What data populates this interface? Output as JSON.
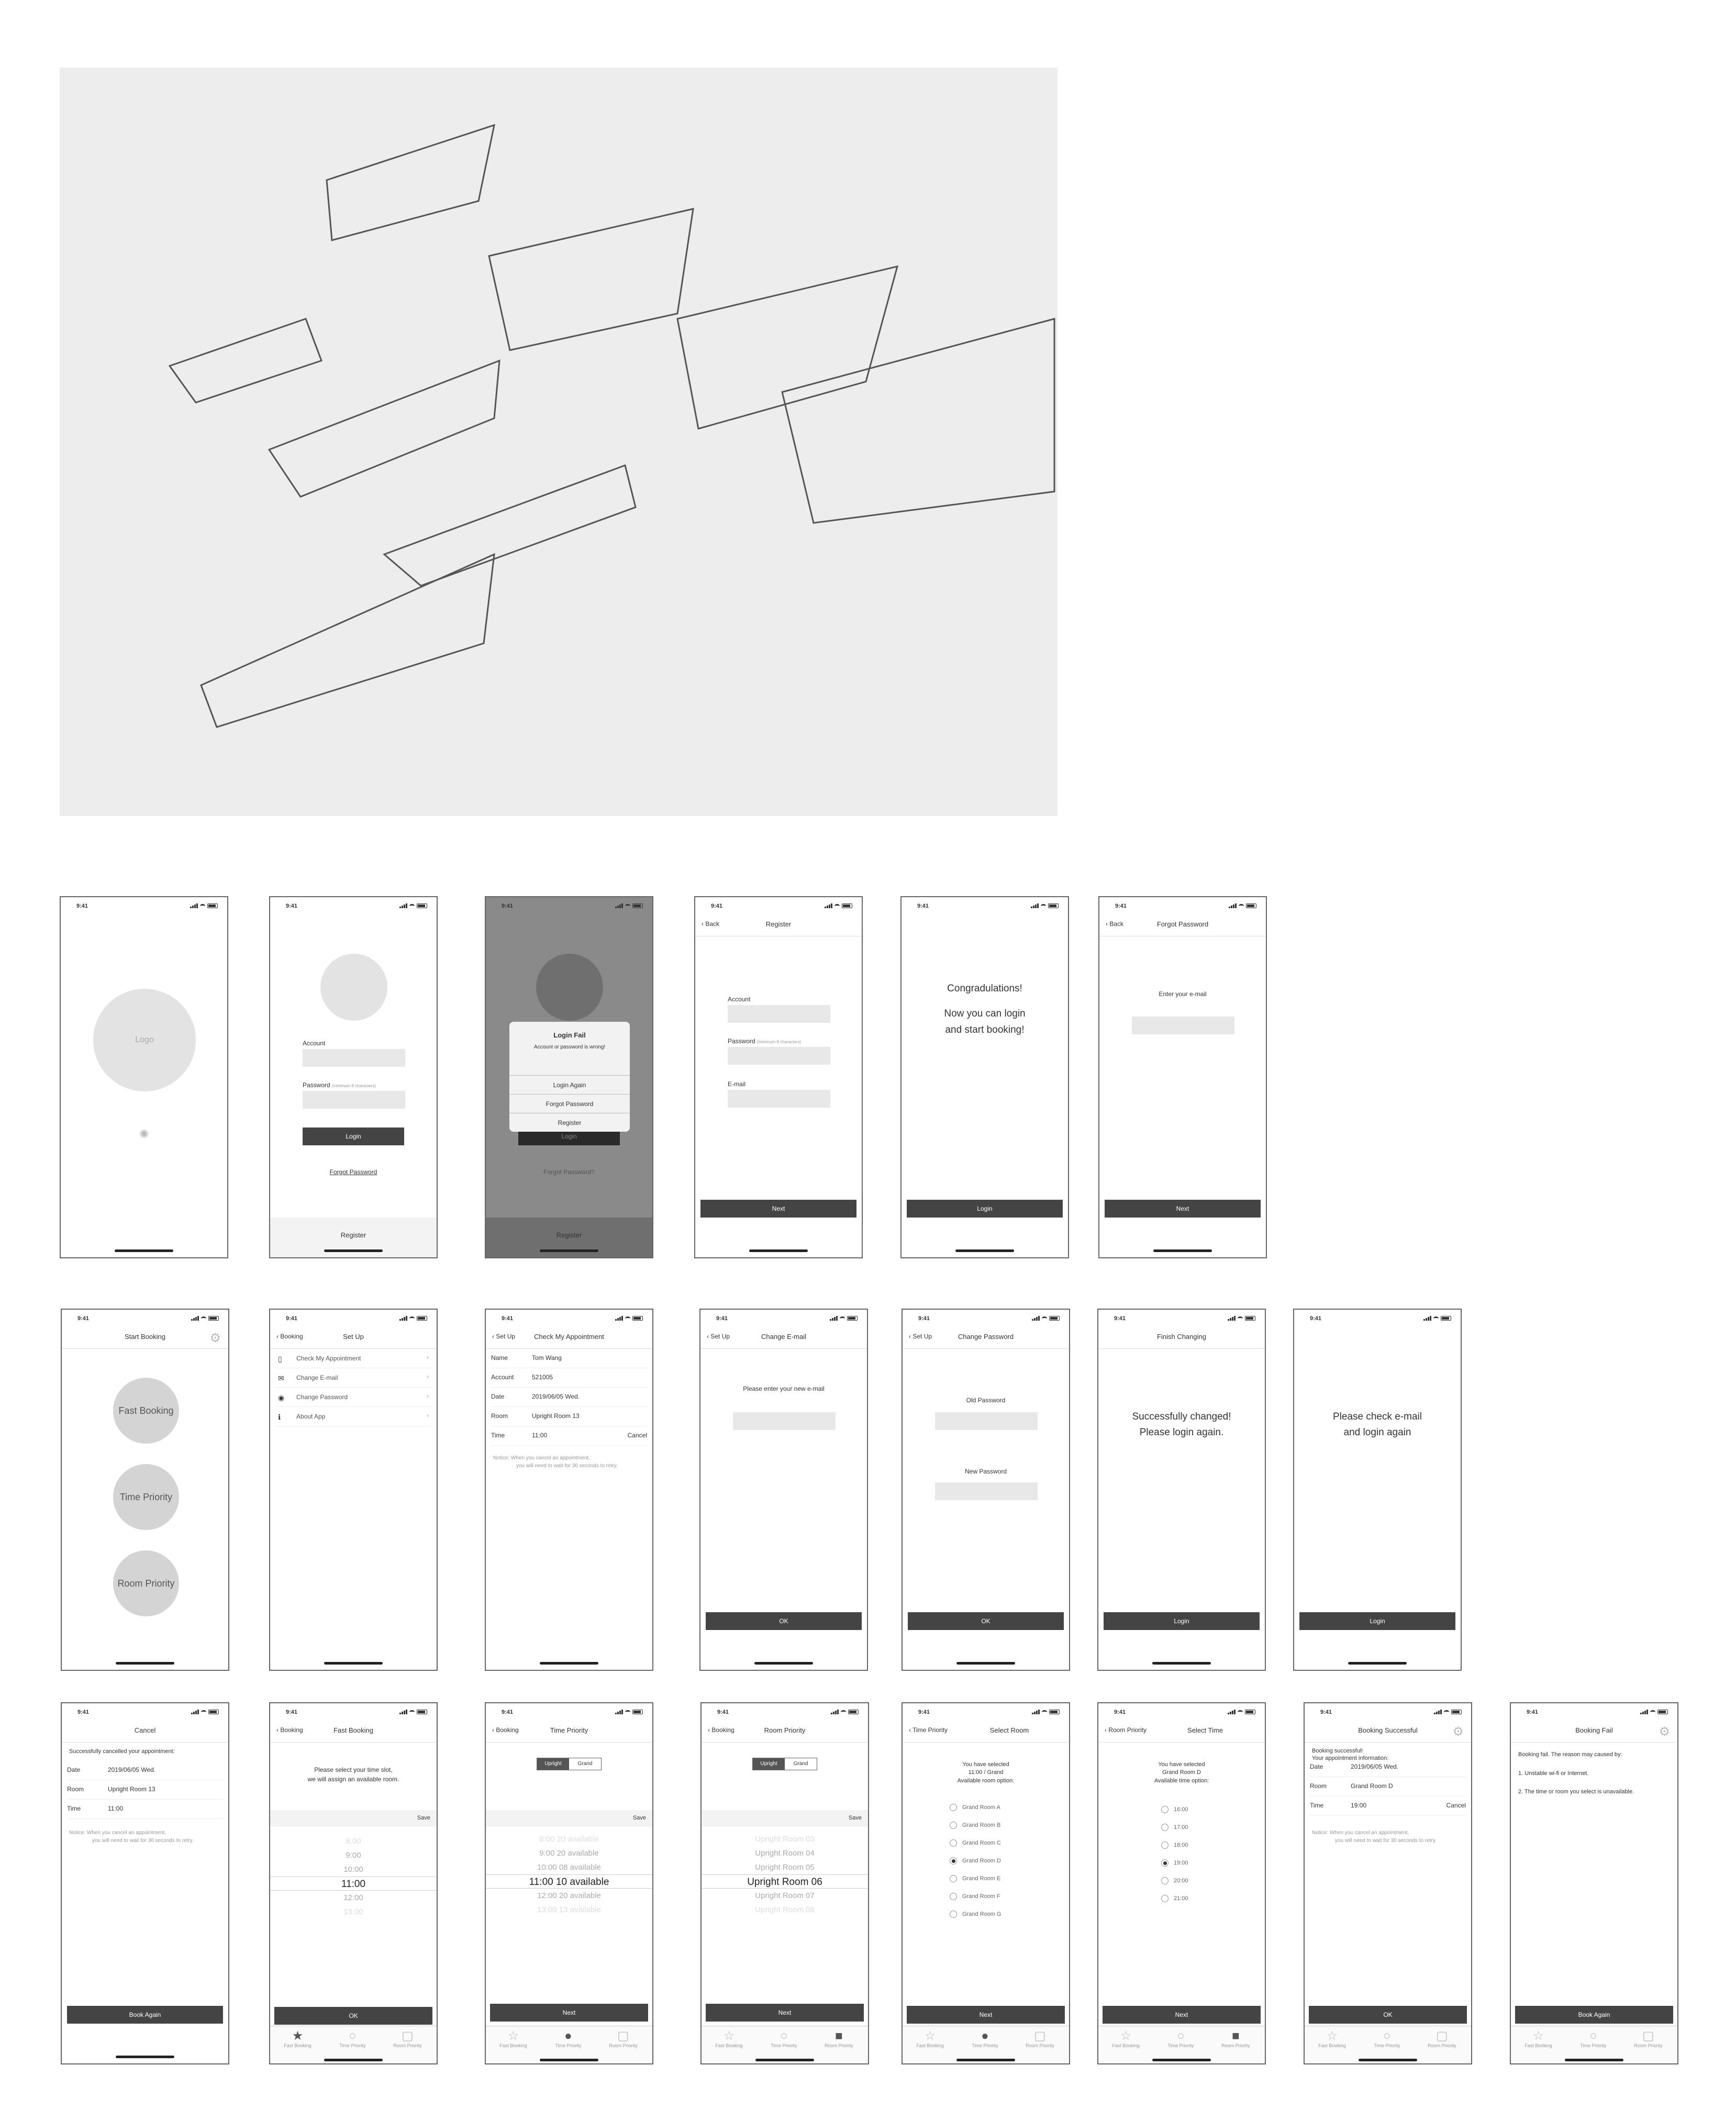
{
  "status_time": "9:41",
  "row1": {
    "splash": {
      "logo": "Logo"
    },
    "login": {
      "account": "Account",
      "password": "Password",
      "password_hint": "(minimum 8 characters)",
      "login_btn": "Login",
      "forgot": "Forgot Password",
      "register": "Register"
    },
    "login_fail": {
      "title": "Login Fail",
      "message": "Account or password is wrong!",
      "opt1": "Login Again",
      "opt2": "Forgot Password",
      "opt3": "Register",
      "forgot": "Forgot Password?",
      "login_btn": "Login",
      "register": "Register"
    },
    "register": {
      "back": "Back",
      "title": "Register",
      "account": "Account",
      "password": "Password",
      "password_hint": "(minimum 8 characters)",
      "email": "E-mail",
      "next": "Next"
    },
    "congrats": {
      "line1": "Congradulations!",
      "line2": "Now you can login",
      "line3": "and start booking!",
      "btn": "Login"
    },
    "forgot": {
      "back": "Back",
      "title": "Forgot Password",
      "prompt": "Enter your e-mail",
      "next": "Next"
    }
  },
  "row2": {
    "start": {
      "title": "Start Booking",
      "b1": "Fast Booking",
      "b2": "Time Priority",
      "b3": "Room Priority"
    },
    "setup": {
      "back": "Booking",
      "title": "Set Up",
      "items": [
        "Check My Appointment",
        "Change E-mail",
        "Change Password",
        "About App"
      ]
    },
    "check": {
      "back": "Set Up",
      "title": "Check My Appointment",
      "rows": [
        [
          "Name",
          "Tom Wang"
        ],
        [
          "Account",
          "521005"
        ],
        [
          "Date",
          "2019/06/05 Wed."
        ],
        [
          "Room",
          "Upright Room 13"
        ],
        [
          "Time",
          "11:00"
        ]
      ],
      "cancel": "Cancel",
      "note1": "Notice: When you cancel an appointment,",
      "note2": "you will need to wait for 30 seconds to retry."
    },
    "change_email": {
      "back": "Set Up",
      "title": "Change E-mail",
      "prompt": "Please enter your new e-mail",
      "ok": "OK"
    },
    "change_pw": {
      "back": "Set Up",
      "title": "Change Password",
      "old": "Old Password",
      "new": "New Password",
      "ok": "OK"
    },
    "finish": {
      "title": "Finish Changing",
      "line1": "Successfully changed!",
      "line2": "Please login again.",
      "btn": "Login"
    },
    "check_email": {
      "line1": "Please check e-mail",
      "line2": "and login again",
      "btn": "Login"
    }
  },
  "row3": {
    "cancel": {
      "title": "Cancel",
      "msg": "Successfully cancelled your appointment:",
      "rows": [
        [
          "Date",
          "2019/06/05 Wed."
        ],
        [
          "Room",
          "Upright Room 13"
        ],
        [
          "Time",
          "11:00"
        ]
      ],
      "note1": "Notice: When you cancel an appointment,",
      "note2": "you will need to wait for 30 seconds to retry.",
      "btn": "Book Again"
    },
    "fast": {
      "back": "Booking",
      "title": "Fast Booking",
      "msg1": "Please select your time slot,",
      "msg2": "we will assign an available room.",
      "save": "Save",
      "items": [
        "8:00",
        "9:00",
        "10:00",
        "11:00",
        "12:00",
        "13:00"
      ],
      "ok": "OK"
    },
    "time": {
      "back": "Booking",
      "title": "Time Priority",
      "seg1": "Upright",
      "seg2": "Grand",
      "save": "Save",
      "items": [
        "8:00  20 available",
        "9:00  20 available",
        "10:00  08 available",
        "11:00  10 available",
        "12:00  20 available",
        "13:00  13 available"
      ],
      "next": "Next"
    },
    "room": {
      "back": "Booking",
      "title": "Room Priority",
      "seg1": "Upright",
      "seg2": "Grand",
      "save": "Save",
      "items": [
        "Upright Room 03",
        "Upright Room 04",
        "Upright Room 05",
        "Upright Room 06",
        "Upright Room 07",
        "Upright Room 08"
      ],
      "next": "Next"
    },
    "select_room": {
      "back": "Time Priority",
      "title": "Select Room",
      "msg1": "You have selected",
      "msg2": "11:00 / Grand",
      "msg3": "Available room option:",
      "options": [
        "Grand Room A",
        "Grand Room B",
        "Grand Room C",
        "Grand Room D",
        "Grand Room E",
        "Grand Room F",
        "Grand Room G"
      ],
      "next": "Next"
    },
    "select_time": {
      "back": "Room Priority",
      "title": "Select Time",
      "msg1": "You have selected",
      "msg2": "Grand Room D",
      "msg3": "Available time option:",
      "options": [
        "16:00",
        "17:00",
        "18:00",
        "19:00",
        "20:00",
        "21:00"
      ],
      "next": "Next"
    },
    "success": {
      "title": "Booking Successful",
      "msg1": "Booking successful!",
      "msg2": "Your appointment information:",
      "rows": [
        [
          "Date",
          "2019/06/05 Wed."
        ],
        [
          "Room",
          "Grand Room D"
        ],
        [
          "Time",
          "19:00"
        ]
      ],
      "cancel": "Cancel",
      "note1": "Notice: When you cancel an appointment,",
      "note2": "you will need to wait for 30 seconds to retry.",
      "ok": "OK"
    },
    "fail": {
      "title": "Booking Fail",
      "msg": "Booking fail. The reason may caused by:",
      "r1": "1. Unstable wi-fi or Internet.",
      "r2": "2. The time or room you select is unavailable.",
      "btn": "Book Again"
    }
  },
  "tabs": {
    "t1": "Fast Booking",
    "t2": "Time Priority",
    "t3": "Room Priority"
  }
}
